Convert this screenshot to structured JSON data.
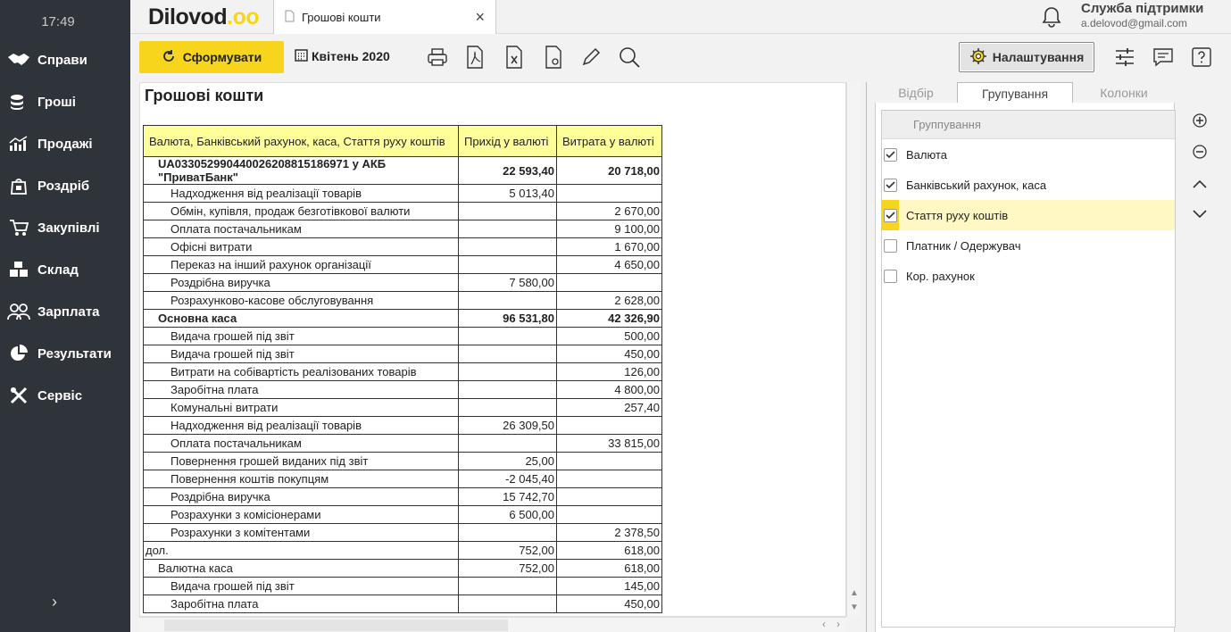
{
  "sidebar": {
    "time": "17:49",
    "items": [
      {
        "label": "Справи",
        "icon": "handshake-icon"
      },
      {
        "label": "Гроші",
        "icon": "coins-icon"
      },
      {
        "label": "Продажі",
        "icon": "chart-icon"
      },
      {
        "label": "Роздріб",
        "icon": "shopping-bag-icon"
      },
      {
        "label": "Закупівлі",
        "icon": "cart-icon"
      },
      {
        "label": "Склад",
        "icon": "boxes-icon"
      },
      {
        "label": "Зарплата",
        "icon": "people-icon"
      },
      {
        "label": "Результати",
        "icon": "pie-icon"
      },
      {
        "label": "Сервіс",
        "icon": "tools-icon"
      }
    ],
    "expand": "›"
  },
  "header": {
    "logo": "Dilovod",
    "logo_dots": ".oo",
    "tab_title": "Грошові кошти",
    "tab_close": "×",
    "support_title": "Служба підтримки",
    "support_email": "a.delovod@gmail.com"
  },
  "toolbar": {
    "generate_label": "Сформувати",
    "period_label": "Квітень 2020",
    "settings_label": "Налаштування"
  },
  "report": {
    "title": "Грошові кошти",
    "headers": [
      "Валюта, Банківський рахунок, каса, Стаття руху коштів",
      "Прихід у валюті",
      "Витрата у валюті"
    ],
    "rows": [
      {
        "name": "UA033052990440026208815186971 у АКБ \"ПриватБанк\"",
        "in": "22 593,40",
        "out": "20 718,00",
        "level": 1,
        "bold": true
      },
      {
        "name": "Надходження від реалізації товарів",
        "in": "5 013,40",
        "out": "",
        "level": 2
      },
      {
        "name": "Обмін, купівля, продаж безготівкової валюти",
        "in": "",
        "out": "2 670,00",
        "level": 2
      },
      {
        "name": "Оплата постачальникам",
        "in": "",
        "out": "9 100,00",
        "level": 2
      },
      {
        "name": "Офісні витрати",
        "in": "",
        "out": "1 670,00",
        "level": 2
      },
      {
        "name": "Переказ на інший рахунок організації",
        "in": "",
        "out": "4 650,00",
        "level": 2
      },
      {
        "name": "Роздрібна виручка",
        "in": "7 580,00",
        "out": "",
        "level": 2
      },
      {
        "name": "Розрахунково-касове обслуговування",
        "in": "",
        "out": "2 628,00",
        "level": 2
      },
      {
        "name": "Основна каса",
        "in": "96 531,80",
        "out": "42 326,90",
        "level": 1,
        "bold": true
      },
      {
        "name": "Видача грошей під звіт",
        "in": "",
        "out": "500,00",
        "level": 2
      },
      {
        "name": "Видача грошей під звіт",
        "in": "",
        "out": "450,00",
        "level": 2
      },
      {
        "name": "Витрати на собівартість реалізованих товарів",
        "in": "",
        "out": "126,00",
        "level": 2
      },
      {
        "name": "Заробітна плата",
        "in": "",
        "out": "4 800,00",
        "level": 2
      },
      {
        "name": "Комунальні витрати",
        "in": "",
        "out": "257,40",
        "level": 2
      },
      {
        "name": "Надходження від реалізації товарів",
        "in": "26 309,50",
        "out": "",
        "level": 2
      },
      {
        "name": "Оплата постачальникам",
        "in": "",
        "out": "33 815,00",
        "level": 2
      },
      {
        "name": "Повернення грошей виданих під звіт",
        "in": "25,00",
        "out": "",
        "level": 2
      },
      {
        "name": "Повернення коштів покупцям",
        "in": "-2 045,40",
        "out": "",
        "level": 2
      },
      {
        "name": "Роздрібна виручка",
        "in": "15 742,70",
        "out": "",
        "level": 2
      },
      {
        "name": "Розрахунки з комісіонерами",
        "in": "6 500,00",
        "out": "",
        "level": 2
      },
      {
        "name": "Розрахунки з комітентами",
        "in": "",
        "out": "2 378,50",
        "level": 2
      },
      {
        "name": "дол.",
        "in": "752,00",
        "out": "618,00",
        "level": 0
      },
      {
        "name": "Валютна каса",
        "in": "752,00",
        "out": "618,00",
        "level": 1
      },
      {
        "name": "Видача грошей під звіт",
        "in": "",
        "out": "145,00",
        "level": 2
      },
      {
        "name": "Заробітна плата",
        "in": "",
        "out": "450,00",
        "level": 2
      }
    ]
  },
  "panel": {
    "tabs": [
      "Відбір",
      "Групування",
      "Колонки"
    ],
    "active_tab": 1,
    "list_header": "Группування",
    "items": [
      {
        "label": "Валюта",
        "checked": true,
        "selected": false
      },
      {
        "label": "Банківський рахунок, каса",
        "checked": true,
        "selected": false
      },
      {
        "label": "Стаття руху коштів",
        "checked": true,
        "selected": true
      },
      {
        "label": "Платник / Одержувач",
        "checked": false,
        "selected": false
      },
      {
        "label": "Кор. рахунок",
        "checked": false,
        "selected": false
      }
    ]
  },
  "colors": {
    "accent": "#f7d51d",
    "sidebar_bg": "#2f343a",
    "table_header": "#ffff99"
  }
}
